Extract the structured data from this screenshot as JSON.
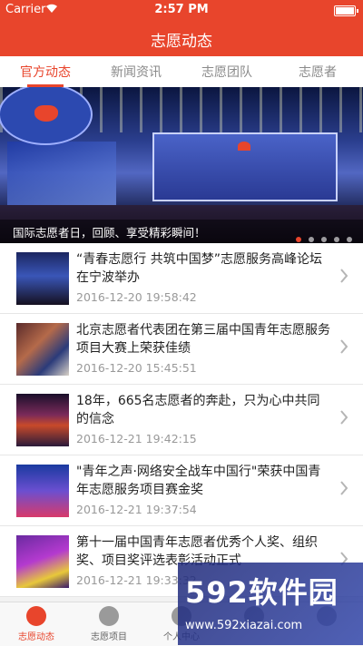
{
  "statusbar": {
    "carrier": "Carrier",
    "time": "2:57 PM"
  },
  "navbar": {
    "title": "志愿动态"
  },
  "tabs": [
    {
      "label": "官方动态"
    },
    {
      "label": "新闻资讯"
    },
    {
      "label": "志愿团队"
    },
    {
      "label": "志愿者"
    }
  ],
  "banner": {
    "caption": "国际志愿者日，回顾、享受精彩瞬间！"
  },
  "news": [
    {
      "title": "“青春志愿行 共筑中国梦”志愿服务高峰论坛在宁波举办",
      "date": "2016-12-20 19:58:42"
    },
    {
      "title": "北京志愿者代表团在第三届中国青年志愿服务项目大赛上荣获佳绩",
      "date": "2016-12-20 15:45:51"
    },
    {
      "title": "18年，665名志愿者的奔赴，只为心中共同的信念",
      "date": "2016-12-21 19:42:15"
    },
    {
      "title": "\"青年之声·网络安全战车中国行\"荣获中国青年志愿服务项目赛金奖",
      "date": "2016-12-21 19:37:54"
    },
    {
      "title": "第十一届中国青年志愿者优秀个人奖、组织奖、项目奖评选表彰活动正式",
      "date": "2016-12-21 19:33:32"
    }
  ],
  "tabbar": [
    {
      "label": "志愿动态"
    },
    {
      "label": "志愿项目"
    },
    {
      "label": "个人中心"
    },
    {
      "label": ""
    },
    {
      "label": ""
    }
  ],
  "watermark": {
    "brand": "592软件园",
    "url": "www.592xiazai.com"
  }
}
